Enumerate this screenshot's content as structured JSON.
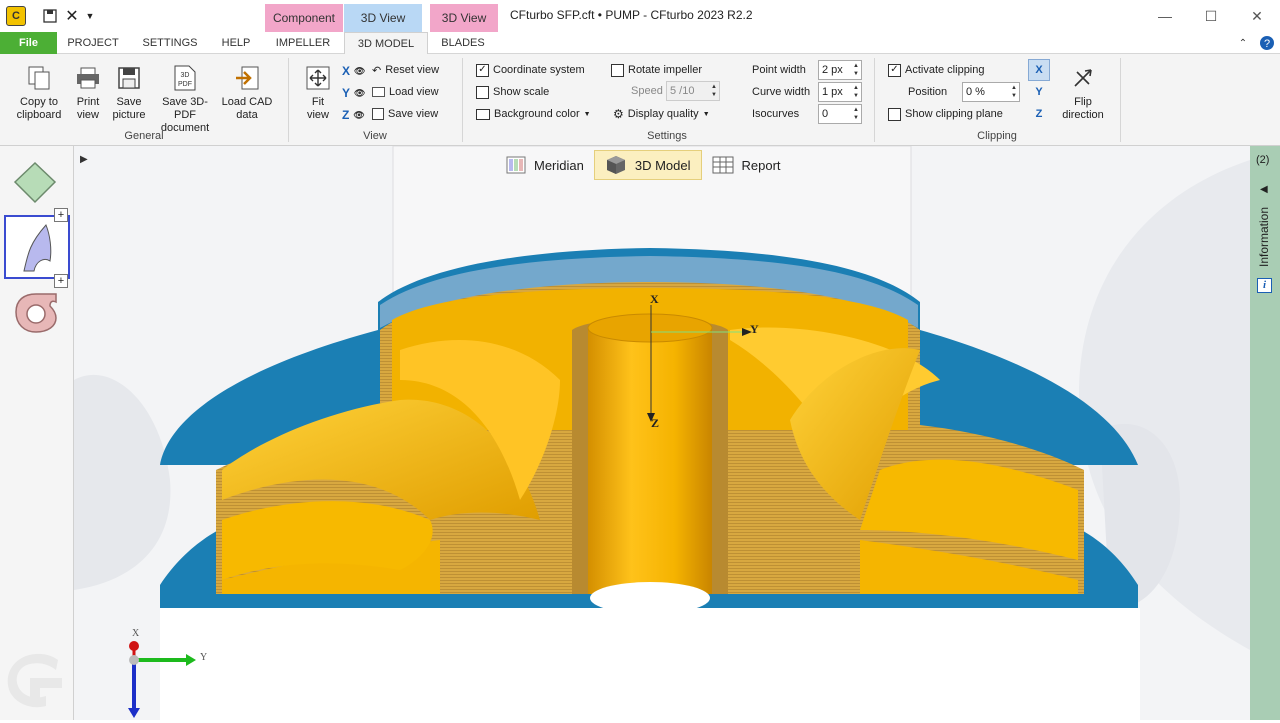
{
  "window": {
    "title": "CFturbo SFP.cft • PUMP - CFturbo 2023 R2.2",
    "context_tabs": [
      "Component",
      "3D View",
      "3D View"
    ]
  },
  "menu": {
    "tabs": [
      "File",
      "PROJECT",
      "SETTINGS",
      "HELP",
      "IMPELLER",
      "3D MODEL",
      "BLADES"
    ],
    "active": "3D MODEL"
  },
  "ribbon": {
    "general": {
      "label": "General",
      "buttons": [
        "Copy to\nclipboard",
        "Print\nview",
        "Save\npicture",
        "Save 3D-PDF\ndocument",
        "Load CAD\ndata"
      ]
    },
    "view": {
      "label": "View",
      "fit_view": "Fit\nview",
      "reset_view": "Reset view",
      "load_view": "Load view",
      "save_view": "Save view"
    },
    "settings": {
      "label": "Settings",
      "coordinate_system": "Coordinate system",
      "coordinate_system_checked": true,
      "show_scale": "Show scale",
      "show_scale_checked": false,
      "background_color": "Background color",
      "rotate_impeller": "Rotate impeller",
      "rotate_impeller_checked": false,
      "speed_label": "Speed",
      "speed_value": "5 /10",
      "display_quality": "Display quality",
      "point_width_label": "Point width",
      "point_width_value": "2 px",
      "curve_width_label": "Curve width",
      "curve_width_value": "1 px",
      "isocurves_label": "Isocurves",
      "isocurves_value": "0"
    },
    "clipping": {
      "label": "Clipping",
      "activate_clipping": "Activate clipping",
      "activate_clipping_checked": true,
      "position_label": "Position",
      "position_value": "0 %",
      "show_clipping_plane": "Show clipping plane",
      "show_clipping_plane_checked": false,
      "flip_direction": "Flip\ndirection"
    }
  },
  "view_tabs": [
    "Meridian",
    "3D Model",
    "Report"
  ],
  "active_view_tab": "3D Model",
  "axes": {
    "x": "X",
    "y": "Y",
    "z": "Z"
  },
  "info_panel": {
    "count": "(2)",
    "label": "Information"
  },
  "colors": {
    "impeller": "#f5b800",
    "volute": "#1b7fb4",
    "file_tab": "#4caf35",
    "info_panel": "#a9cdb4"
  }
}
